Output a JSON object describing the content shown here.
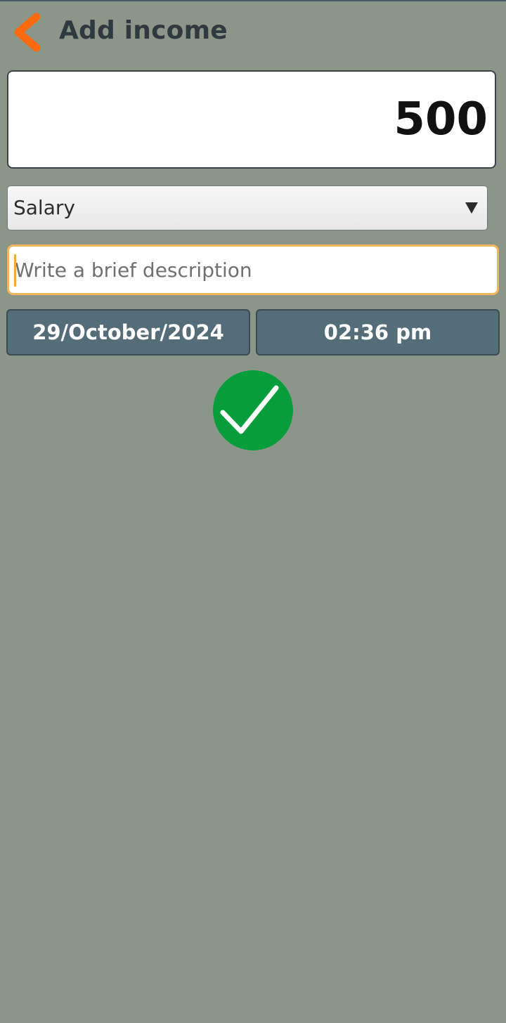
{
  "header": {
    "title": "Add income",
    "back_icon": "chevron-left-icon",
    "accent_color": "#ff6a0e"
  },
  "amount": {
    "value": "500"
  },
  "category": {
    "selected": "Salary",
    "icon": "dropdown-triangle-icon"
  },
  "description": {
    "value": "",
    "placeholder": "Write a brief description"
  },
  "datetime": {
    "date": "29/October/2024",
    "time": "02:36 pm"
  },
  "confirm": {
    "icon": "checkmark-icon",
    "color": "#069d3a"
  },
  "colors": {
    "background": "#8a9788",
    "date_time_button": "#546d79",
    "focus_border": "#f2b65a"
  }
}
